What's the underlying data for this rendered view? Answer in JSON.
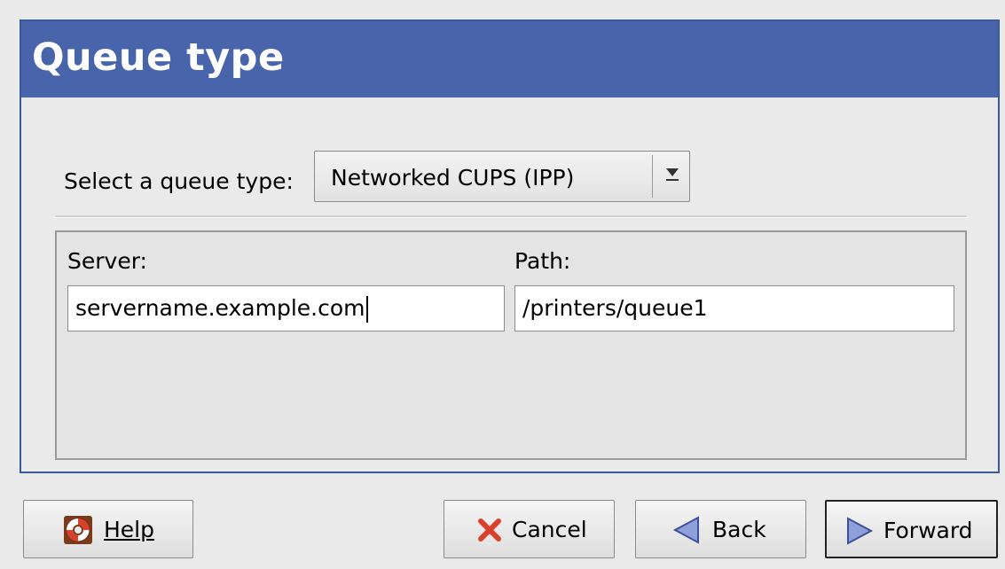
{
  "header": {
    "title": "Queue type"
  },
  "queue": {
    "label": "Select a queue type:",
    "selected_value": "Networked CUPS (IPP)"
  },
  "fields": {
    "server_label": "Server:",
    "server_value": "servername.example.com",
    "path_label": "Path:",
    "path_value": "/printers/queue1"
  },
  "buttons": {
    "help": "Help",
    "cancel": "Cancel",
    "back": "Back",
    "forward": "Forward"
  },
  "colors": {
    "header_bg": "#4865ac",
    "cancel_icon": "#d9412c",
    "nav_arrow": "#8f9fd9"
  },
  "icons": {
    "help": "lifebuoy-icon",
    "cancel": "x-icon",
    "back": "left-arrow-icon",
    "forward": "right-arrow-icon",
    "select": "chevron-down-icon"
  }
}
